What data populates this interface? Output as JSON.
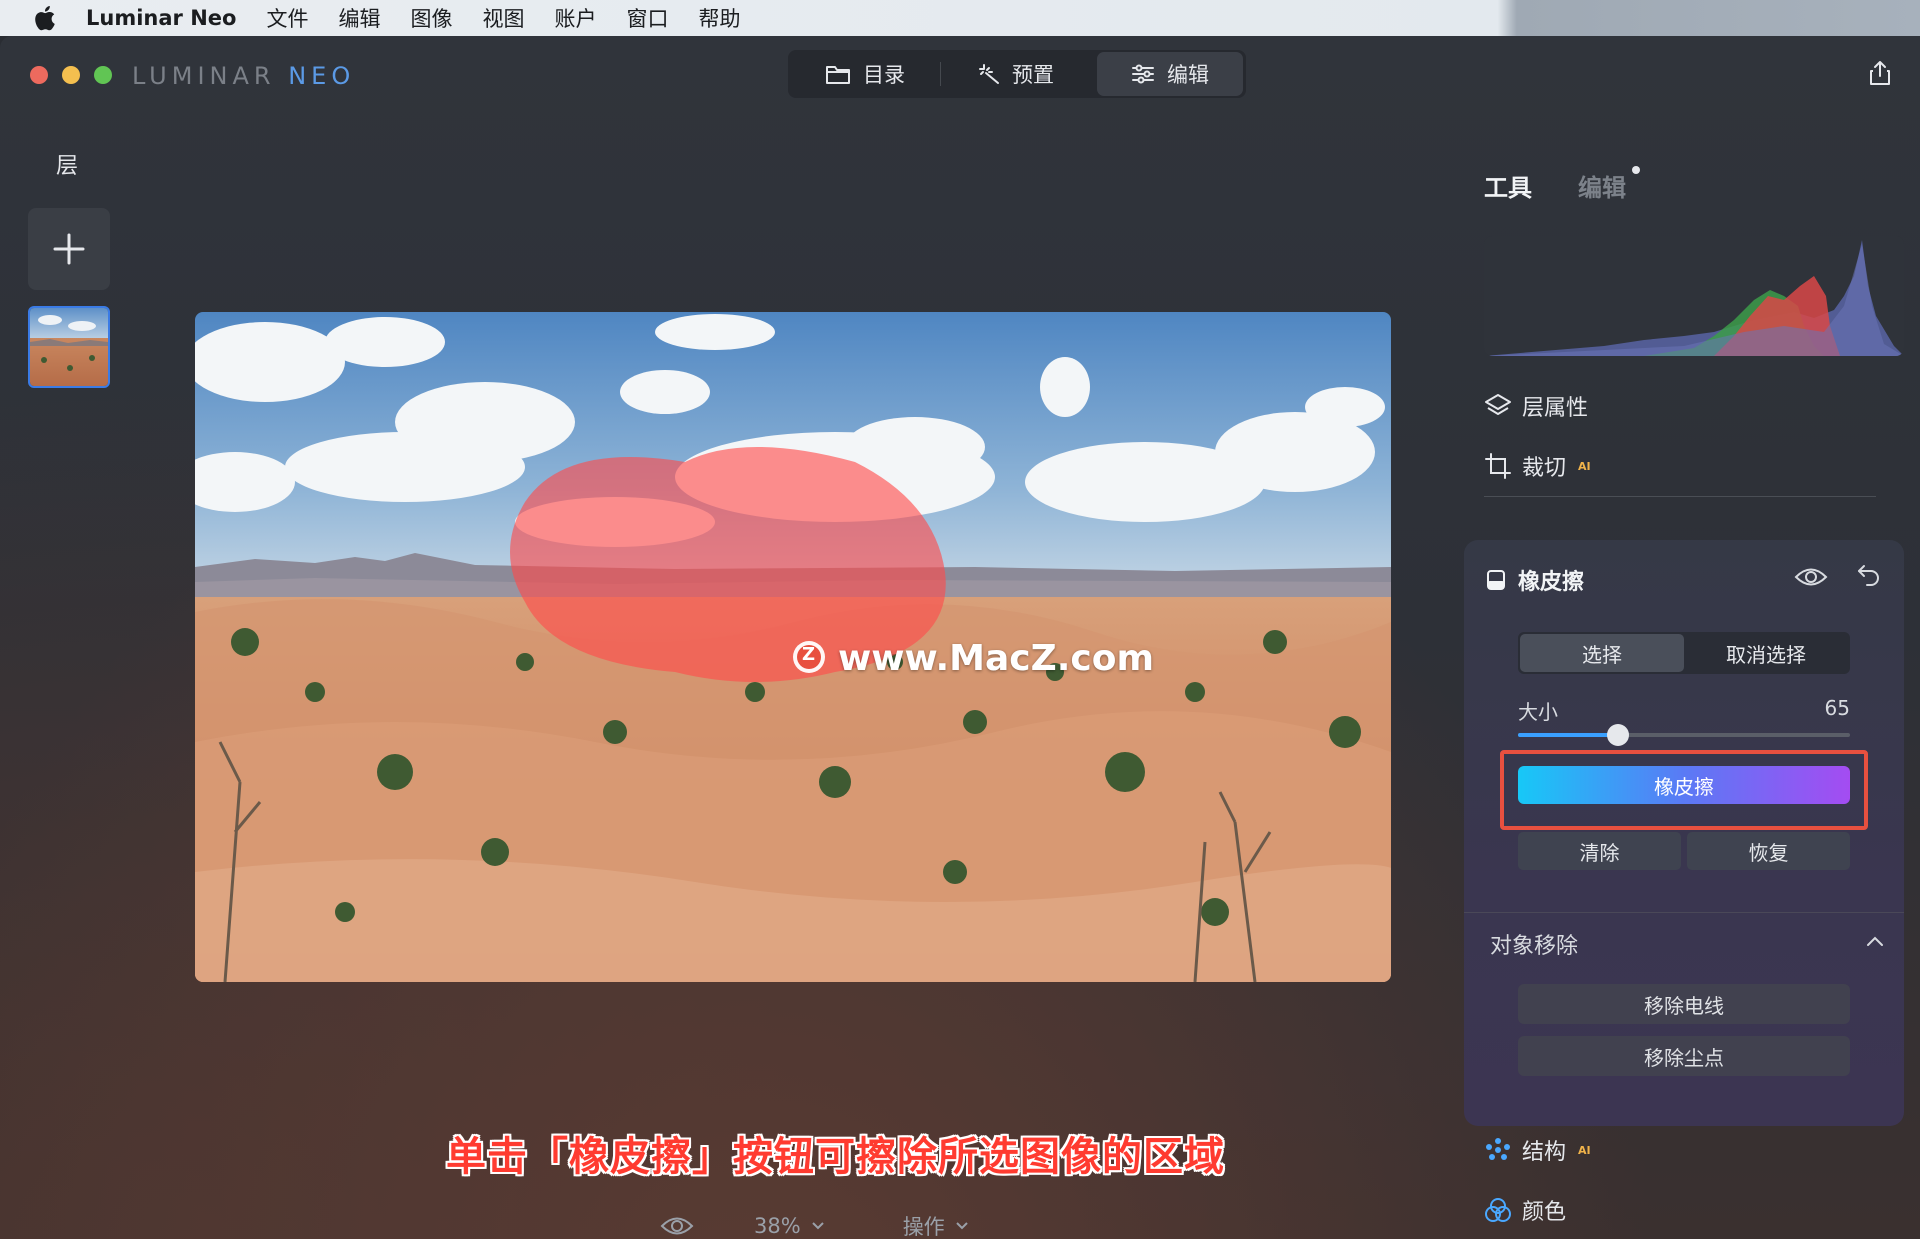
{
  "menubar": {
    "app_name": "Luminar Neo",
    "items": [
      "文件",
      "编辑",
      "图像",
      "视图",
      "账户",
      "窗口",
      "帮助"
    ]
  },
  "brand": {
    "part1": "LUMINAR ",
    "part2": "NEO"
  },
  "mode_tabs": [
    {
      "label": "目录",
      "icon": "folder-icon"
    },
    {
      "label": "预置",
      "icon": "magic-wand-icon"
    },
    {
      "label": "编辑",
      "icon": "sliders-icon",
      "active": true
    }
  ],
  "layers": {
    "title": "层"
  },
  "canvas": {
    "watermark": "www.MacZ.com",
    "watermark_badge": "Z"
  },
  "caption": "单击「橡皮擦」按钮可擦除所选图像的区域",
  "bottom_bar": {
    "zoom": "38%",
    "ops": "操作"
  },
  "panel": {
    "tabs": {
      "tools": "工具",
      "edits": "编辑"
    },
    "layer_props": "层属性",
    "crop": "裁切",
    "crop_badge": "AI",
    "structure": "结构",
    "structure_badge": "AI",
    "color": "颜色"
  },
  "eraser": {
    "title": "橡皮擦",
    "select": "选择",
    "deselect": "取消选择",
    "size_label": "大小",
    "size_value": "65",
    "size_level": 0.3,
    "erase_button": "橡皮擦",
    "clear": "清除",
    "restore": "恢复"
  },
  "object_removal": {
    "title": "对象移除",
    "remove_lines": "移除电线",
    "remove_dust": "移除尘点"
  },
  "colors": {
    "accent_blue": "#3a7be6",
    "highlight_red": "#e8503f"
  }
}
